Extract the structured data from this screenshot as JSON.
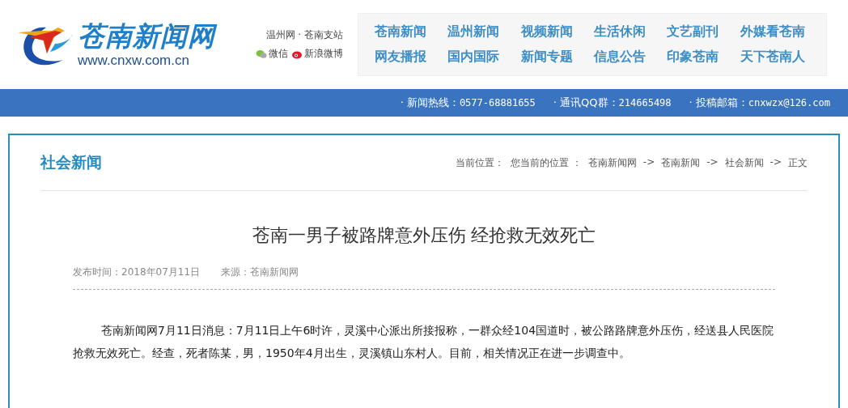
{
  "logo": {
    "name": "苍南新闻网",
    "url": "www.cnxw.com.cn"
  },
  "site_links": {
    "affiliation": "温州网 · 苍南支站",
    "social": [
      "微信",
      "新浪微博"
    ]
  },
  "nav": [
    {
      "label": "苍南新闻"
    },
    {
      "label": "温州新闻"
    },
    {
      "label": "视频新闻"
    },
    {
      "label": "生活休闲"
    },
    {
      "label": "文艺副刊"
    },
    {
      "label": "外媒看苍南"
    },
    {
      "label": "网友播报"
    },
    {
      "label": "国内国际"
    },
    {
      "label": "新闻专题"
    },
    {
      "label": "信息公告"
    },
    {
      "label": "印象苍南"
    },
    {
      "label": "天下苍南人"
    }
  ],
  "contact_bar": [
    {
      "label": "· 新闻热线：",
      "value": "0577-68881655"
    },
    {
      "label": "· 通讯QQ群：",
      "value": "214665498"
    },
    {
      "label": "· 投稿邮箱：",
      "value": "cnxwzx@126.com"
    }
  ],
  "section": {
    "title": "社会新闻",
    "breadcrumb_label": "当前位置：",
    "breadcrumb_intro": "您当前的位置 ：",
    "breadcrumb": [
      "苍南新闻网",
      "苍南新闻",
      "社会新闻",
      "正文"
    ],
    "separator": "->"
  },
  "article": {
    "title": "苍南一男子被路牌意外压伤 经抢救无效死亡",
    "published": "发布时间：2018年07月11日",
    "source": "来源：苍南新闻网",
    "body": "苍南新闻网7月11日消息：7月11日上午6时许，灵溪中心派出所接报称，一群众经104国道时，被公路路牌意外压伤，经送县人民医院抢救无效死亡。经查，死者陈某，男，1950年4月出生，灵溪镇山东村人。目前，相关情况正在进一步调查中。"
  }
}
